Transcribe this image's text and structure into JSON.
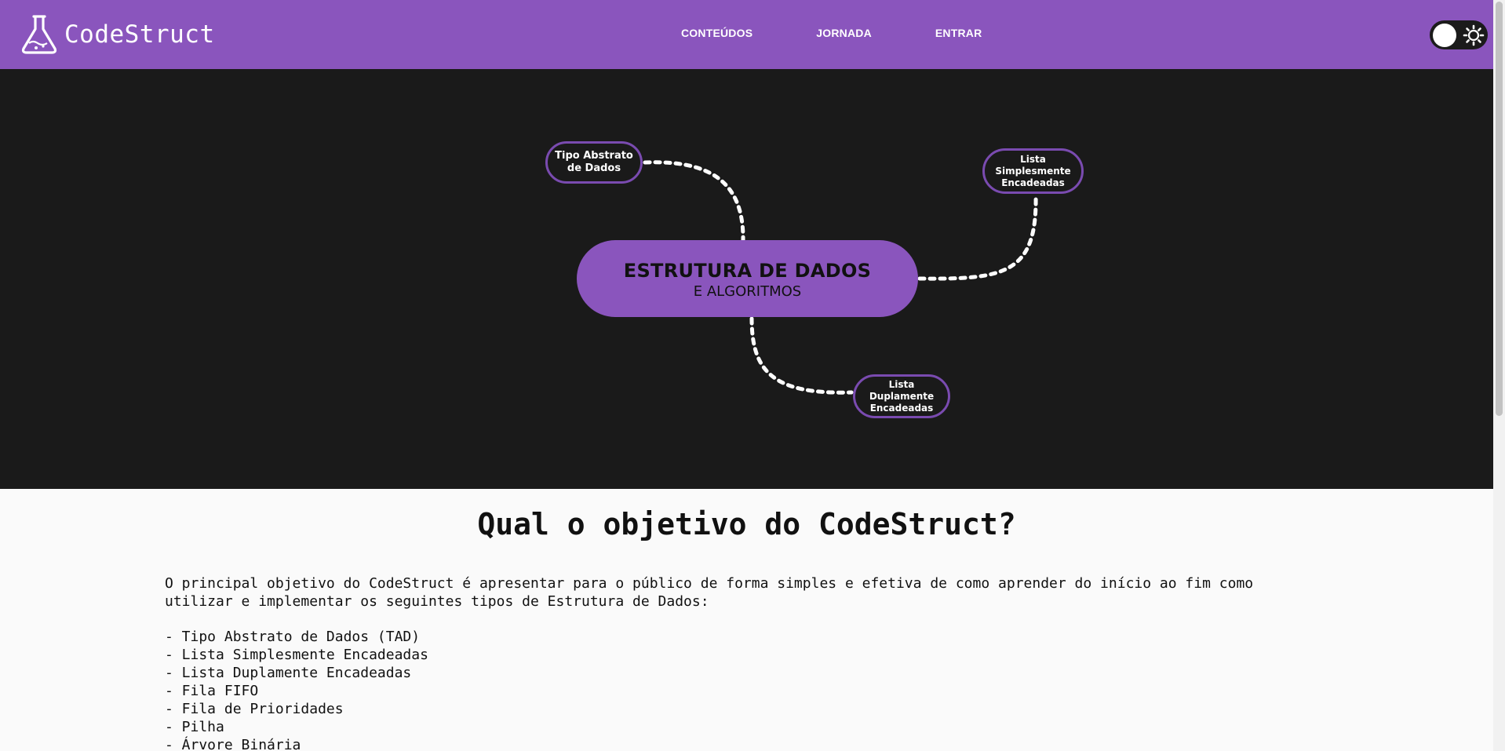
{
  "brand": {
    "name": "CodeStruct",
    "icon": "flask-icon"
  },
  "nav": {
    "items": [
      {
        "label": "CONTEÚDOS"
      },
      {
        "label": "JORNADA"
      },
      {
        "label": "ENTRAR"
      }
    ]
  },
  "theme_toggle": {
    "icon": "sun-icon",
    "state": "off"
  },
  "hero": {
    "center_title": "ESTRUTURA DE DADOS",
    "center_subtitle": "E ALGORITMOS",
    "nodes": {
      "tad": "Tipo Abstrato de Dados",
      "lse": "Lista Simplesmente Encadeadas",
      "lde": "Lista Duplamente Encadeadas"
    }
  },
  "about": {
    "title": "Qual o objetivo do CodeStruct?",
    "paragraph": "O principal objetivo do CodeStruct é apresentar para o público de forma simples e efetiva de como aprender do início ao fim como utilizar e implementar os seguintes tipos de Estrutura de Dados:",
    "topics": [
      "- Tipo Abstrato de Dados (TAD)",
      "- Lista Simplesmente Encadeadas",
      "- Lista Duplamente Encadeadas",
      "- Fila FIFO",
      "- Fila de Prioridades",
      "- Pilha",
      "- Árvore Binária"
    ]
  },
  "colors": {
    "accent": "#8a55bd",
    "hero_background": "#1a1a1a",
    "page_background": "#fafafa"
  }
}
